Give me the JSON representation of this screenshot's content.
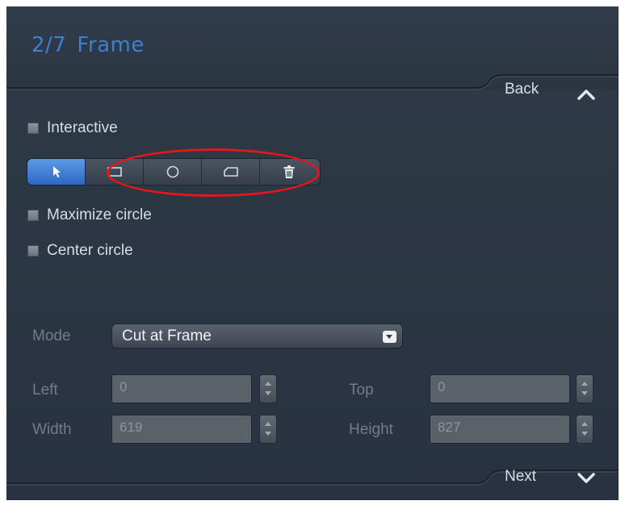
{
  "header": {
    "step": "2/7",
    "title": "Frame"
  },
  "nav": {
    "back_label": "Back",
    "next_label": "Next"
  },
  "options": {
    "interactive_label": "Interactive",
    "maximize_label": "Maximize circle",
    "center_label": "Center circle"
  },
  "toolbar": {
    "tools": [
      {
        "icon": "pointer-icon",
        "active": true
      },
      {
        "icon": "rectangle-icon",
        "active": false
      },
      {
        "icon": "circle-icon",
        "active": false
      },
      {
        "icon": "freeform-shape-icon",
        "active": false
      },
      {
        "icon": "trash-icon",
        "active": false
      }
    ]
  },
  "mode": {
    "label": "Mode",
    "value": "Cut at Frame"
  },
  "fields": {
    "left": {
      "label": "Left",
      "value": "0"
    },
    "top": {
      "label": "Top",
      "value": "0"
    },
    "width": {
      "label": "Width",
      "value": "619"
    },
    "height": {
      "label": "Height",
      "value": "827"
    }
  },
  "colors": {
    "panel_bg": "#2c3644",
    "title_blue": "#3d7fd3",
    "active_tool": "#3a78d6",
    "annotation_red": "#e4161c"
  }
}
